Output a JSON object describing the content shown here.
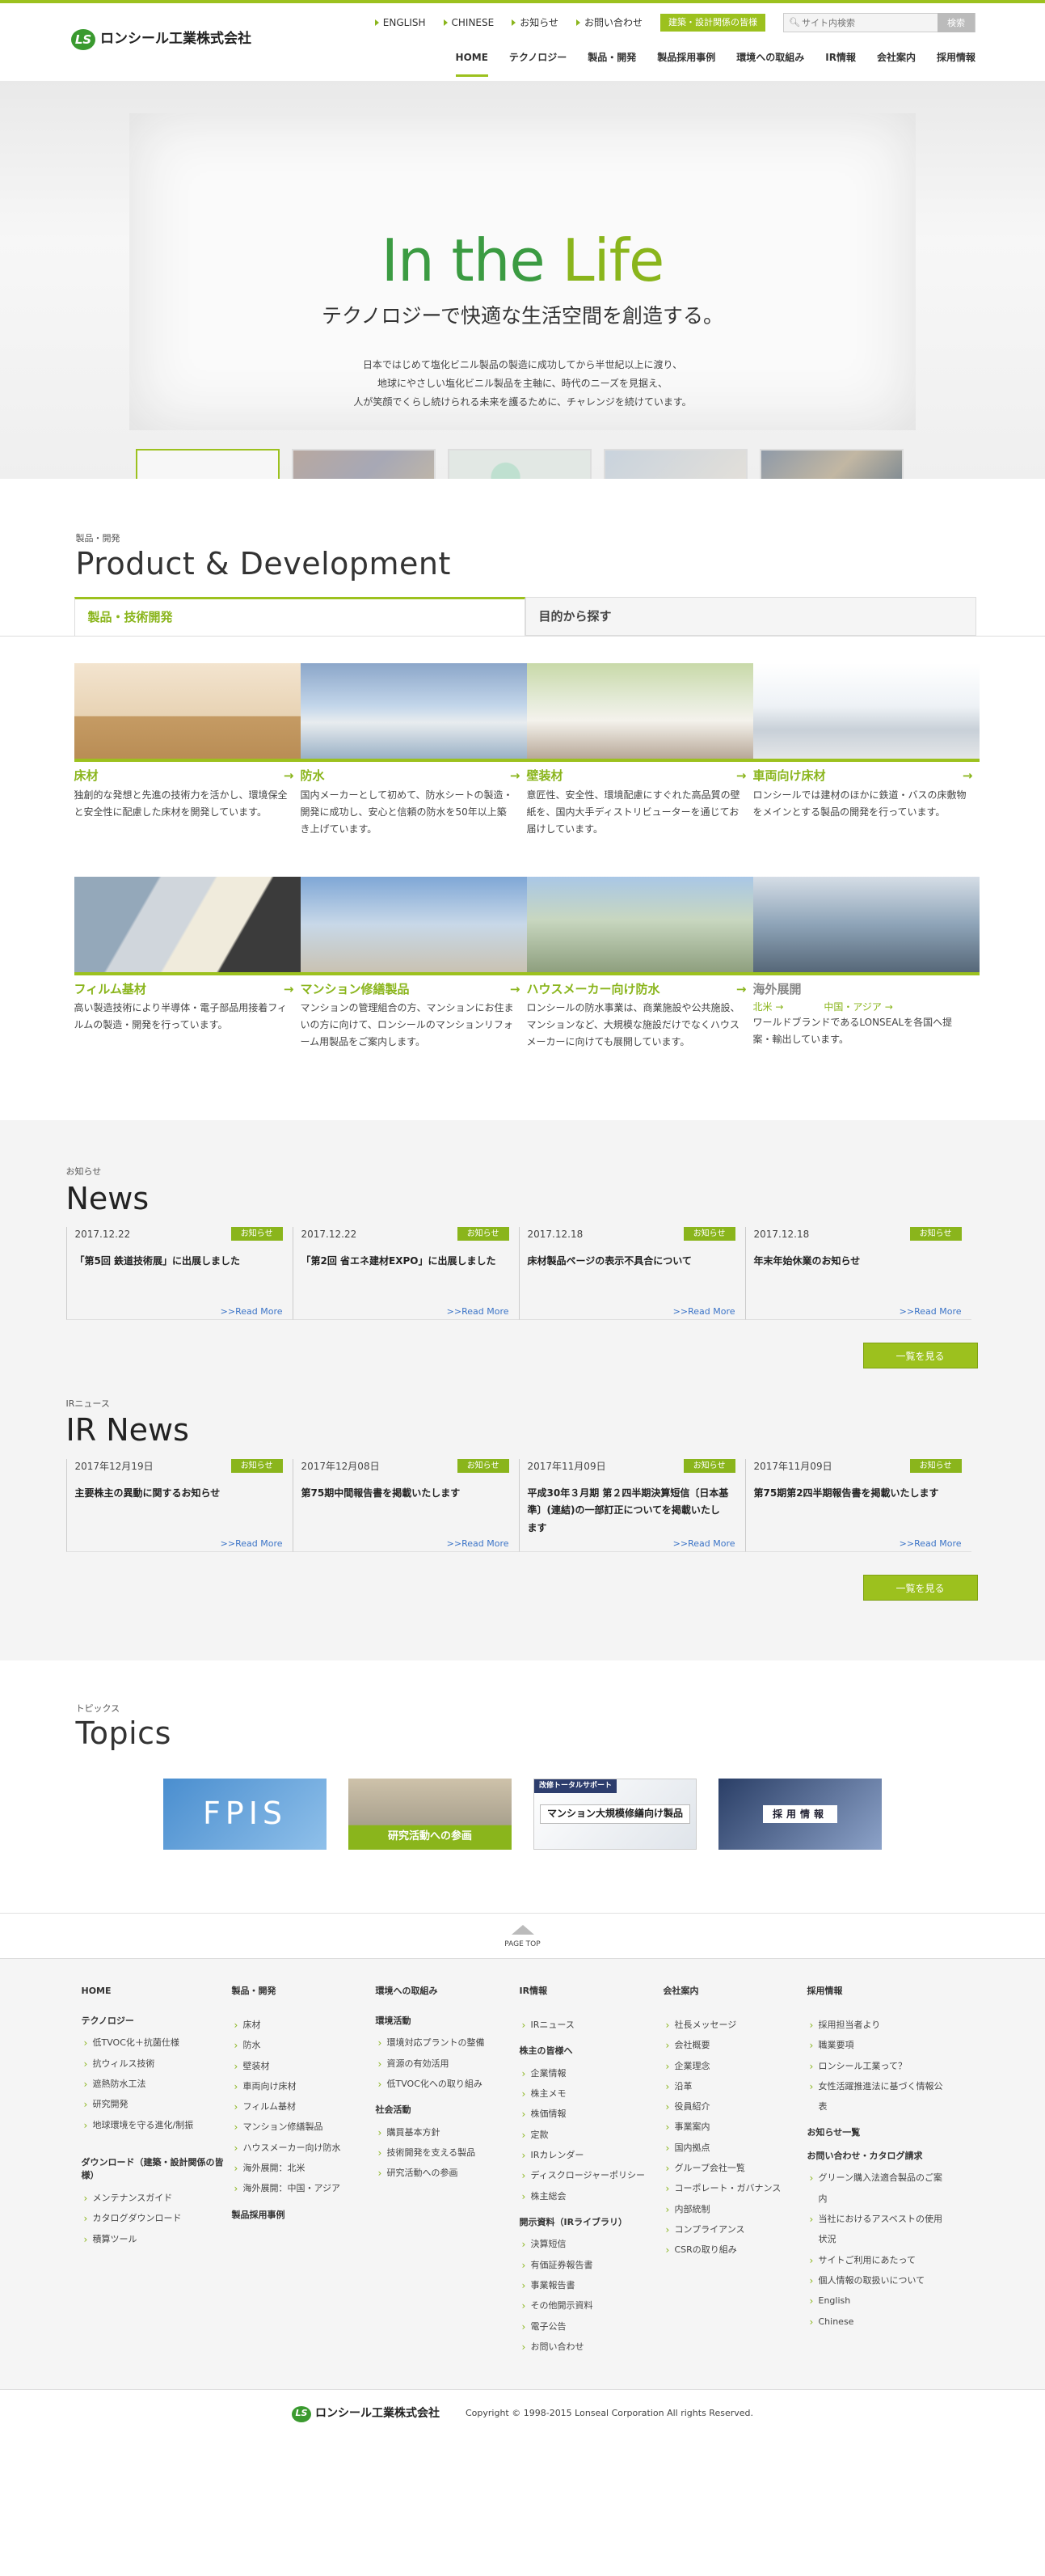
{
  "header": {
    "logo_text": "ロンシール工業株式会社",
    "logo_mark": "LS",
    "utility": [
      "ENGLISH",
      "CHINESE",
      "お知らせ",
      "お問い合わせ"
    ],
    "design_button": "建築・設計関係の皆様",
    "search_placeholder": "サイト内検索",
    "search_button": "検索",
    "nav": [
      "HOME",
      "テクノロジー",
      "製品・開発",
      "製品採用事例",
      "環境への取組み",
      "IR情報",
      "会社案内",
      "採用情報"
    ]
  },
  "hero": {
    "title_part1": "In the ",
    "title_part2": "Life",
    "subtitle": "テクノロジーで快適な生活空間を創造する。",
    "desc_lines": [
      "日本ではじめて塩化ビニル製品の製造に成功してから半世紀以上に渡り、",
      "地球にやさしい塩化ビニル製品を主軸に、時代のニーズを見据え、",
      "人が笑顔でくらし続けられる未来を護るために、チャレンジを続けています。"
    ]
  },
  "product": {
    "small": "製品・開発",
    "title": "Product & Development",
    "tabs": [
      "製品・技術開発",
      "目的から探す"
    ],
    "items": [
      {
        "name": "床材",
        "text": "独創的な発想と先進の技術力を活かし、環境保全と安全性に配慮した床材を開発しています。"
      },
      {
        "name": "防水",
        "text": "国内メーカーとして初めて、防水シートの製造・開発に成功し、安心と信頼の防水を50年以上築き上げています。"
      },
      {
        "name": "壁装材",
        "text": "意匠性、安全性、環境配慮にすぐれた高品質の壁紙を、国内大手ディストリビューターを通じてお届けしています。"
      },
      {
        "name": "車両向け床材",
        "text": "ロンシールでは建材のほかに鉄道・バスの床敷物をメインとする製品の開発を行っています。"
      },
      {
        "name": "フィルム基材",
        "text": "高い製造技術により半導体・電子部品用接着フィルムの製造・開発を行っています。"
      },
      {
        "name": "マンション修繕製品",
        "text": "マンションの管理組合の方、マンションにお住まいの方に向けて、ロンシールのマンションリフォーム用製品をご案内します。"
      },
      {
        "name": "ハウスメーカー向け防水",
        "text": "ロンシールの防水事業は、商業施設や公共施設、マンションなど、大規模な施設だけでなくハウスメーカーに向けても展開しています。"
      },
      {
        "name": "海外展開",
        "text": "ワールドブランドであるLONSEALを各国へ提案・輸出しています。",
        "sub": [
          "北米",
          "中国・アジア"
        ]
      }
    ]
  },
  "news": {
    "small": "お知らせ",
    "title": "News",
    "badge": "お知らせ",
    "more": ">>Read More",
    "button": "一覧を見る",
    "items": [
      {
        "date": "2017.12.22",
        "head": "「第5回 鉄道技術展」に出展しました"
      },
      {
        "date": "2017.12.22",
        "head": "「第2回 省エネ建材EXPO」に出展しました"
      },
      {
        "date": "2017.12.18",
        "head": "床材製品ページの表示不具合について"
      },
      {
        "date": "2017.12.18",
        "head": "年末年始休業のお知らせ"
      }
    ]
  },
  "ir": {
    "small": "IRニュース",
    "title": "IR News",
    "badge": "お知らせ",
    "more": ">>Read More",
    "button": "一覧を見る",
    "items": [
      {
        "date": "2017年12月19日",
        "head": "主要株主の異動に関するお知らせ"
      },
      {
        "date": "2017年12月08日",
        "head": "第75期中間報告書を掲載いたします"
      },
      {
        "date": "2017年11月09日",
        "head": "平成30年３月期 第２四半期決算短信〔日本基準〕(連結)の一部訂正についてを掲載いたします"
      },
      {
        "date": "2017年11月09日",
        "head": "第75期第2四半期報告書を掲載いたします"
      }
    ]
  },
  "topics": {
    "small": "トピックス",
    "title": "Topics",
    "banners": {
      "b1": "FPIS",
      "b2": "研究活動への参画",
      "b3_tag": "改修トータルサポート",
      "b3": "マンション大規模修繕向け製品",
      "b4": "採用情報"
    }
  },
  "pagetop": "PAGE TOP",
  "sitemap": {
    "c1": {
      "items1": [
        "HOME"
      ],
      "h2": "テクノロジー",
      "items2": [
        "低TVOC化＋抗菌仕様",
        "抗ウィルス技術",
        "遮熱防水工法",
        "研究開発",
        "地球環境を守る進化/制振"
      ],
      "h3": "ダウンロード（建築・設計関係の皆様）",
      "items3": [
        "メンテナンスガイド",
        "カタログダウンロード",
        "積算ツール"
      ]
    },
    "c2": {
      "h1": "製品・開発",
      "items1": [
        "床材",
        "防水",
        "壁装材",
        "車両向け床材",
        "フィルム基材",
        "マンション修繕製品",
        "ハウスメーカー向け防水",
        "海外展開：北米",
        "海外展開：中国・アジア"
      ],
      "h2": "製品採用事例"
    },
    "c3": {
      "h1": "環境への取組み",
      "h2": "環境活動",
      "items2": [
        "環境対応プラントの整備",
        "資源の有効活用",
        "低TVOC化への取り組み"
      ],
      "h3": "社会活動",
      "items3": [
        "購買基本方針",
        "技術開発を支える製品",
        "研究活動への参画"
      ]
    },
    "c4": {
      "h1": "IR情報",
      "items1": [
        "IRニュース"
      ],
      "h2": "株主の皆様へ",
      "items2": [
        "企業情報",
        "株主メモ",
        "株価情報",
        "定款",
        "IRカレンダー",
        "ディスクロージャーポリシー",
        "株主総会"
      ],
      "h3": "開示資料（IRライブラリ）",
      "items3": [
        "決算短信",
        "有価証券報告書",
        "事業報告書",
        "その他開示資料"
      ],
      "items4": [
        "電子公告",
        "お問い合わせ"
      ]
    },
    "c5": {
      "h1": "会社案内",
      "items1": [
        "社長メッセージ",
        "会社概要",
        "企業理念",
        "沿革",
        "役員紹介",
        "事業案内",
        "国内拠点",
        "グループ会社一覧",
        "コーポレート・ガバナンス",
        "内部統制",
        "コンプライアンス",
        "CSRの取り組み"
      ]
    },
    "c6": {
      "h1": "採用情報",
      "items1": [
        "採用担当者より",
        "職業要項",
        "ロンシール工業って？",
        "女性活躍推進法に基づく情報公表"
      ],
      "h2": "お知らせ一覧",
      "h3": "お問い合わせ・カタログ請求",
      "items3": [
        "グリーン購入法適合製品のご案内",
        "当社におけるアスベストの使用状況",
        "サイトご利用にあたって",
        "個人情報の取扱いについて",
        "English",
        "Chinese"
      ]
    }
  },
  "footer": {
    "logo_text": "ロンシール工業株式会社",
    "copyright": "Copyright © 1998-2015 Lonseal Corporation All rights Reserved."
  }
}
